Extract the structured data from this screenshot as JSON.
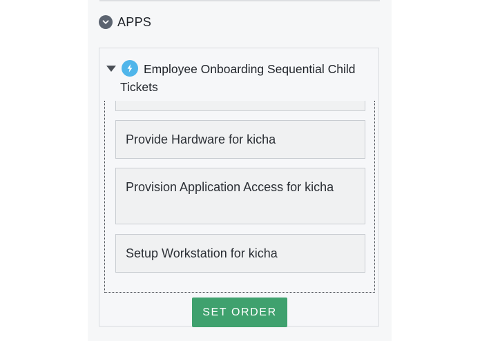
{
  "section": {
    "title": "APPS",
    "collapse_icon": "chevron-down-circle-icon"
  },
  "app": {
    "icon": "lightning-bolt-icon",
    "icon_color": "#4fb5ea",
    "title": "Employee Onboarding Sequential Child Tickets",
    "tickets": [
      {
        "label": ""
      },
      {
        "label": "Provide Hardware for kicha"
      },
      {
        "label": "Provision Application Access for kicha"
      },
      {
        "label": "Setup Workstation for kicha"
      }
    ]
  },
  "actions": {
    "set_order_label": "SET ORDER",
    "set_order_color": "#3fa16e"
  }
}
